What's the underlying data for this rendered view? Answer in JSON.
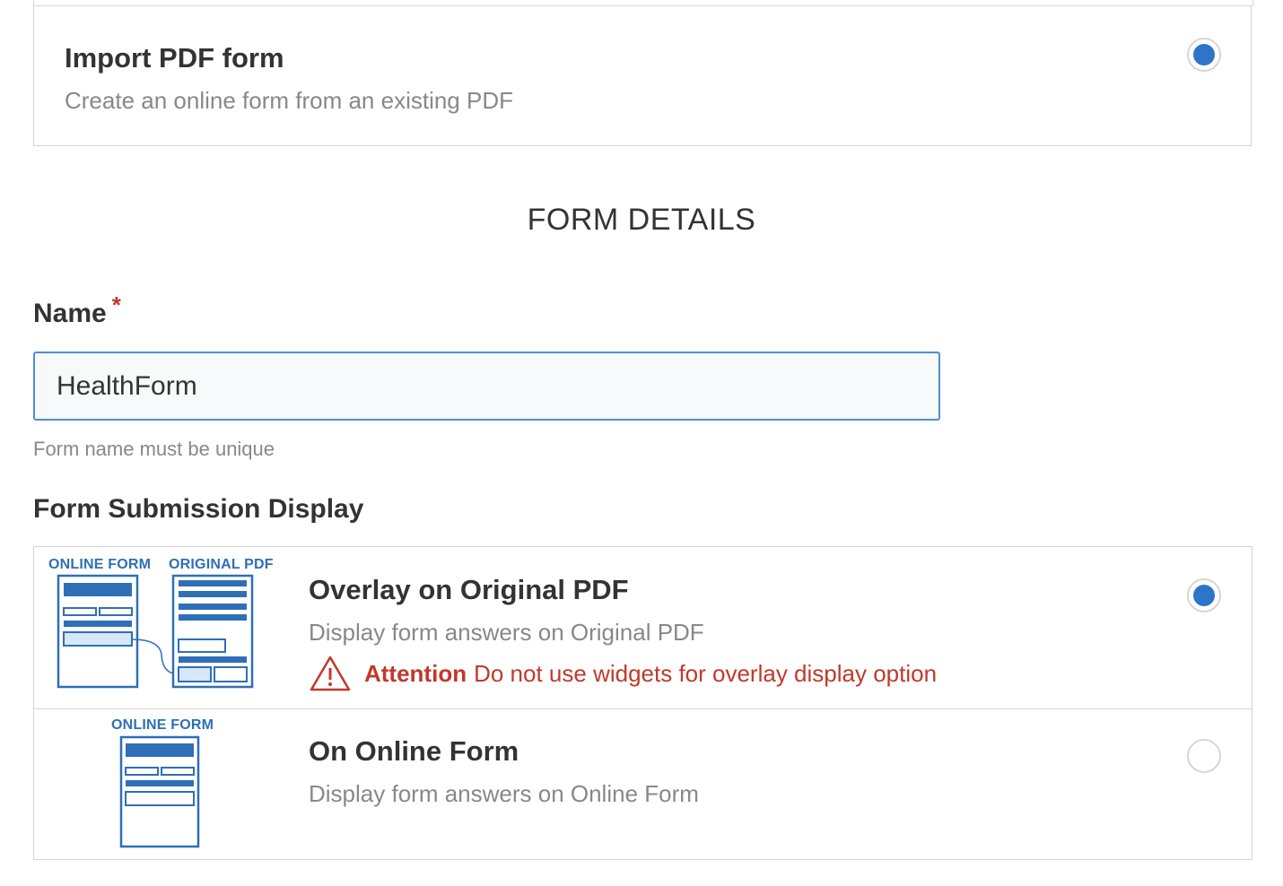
{
  "import_option": {
    "title": "Import PDF form",
    "subtitle": "Create an online form from an existing PDF",
    "selected": true
  },
  "section_heading": "FORM DETAILS",
  "name_field": {
    "label": "Name",
    "required_marker": "*",
    "value": "HealthForm",
    "help_text": "Form name must be unique"
  },
  "submission_display": {
    "label": "Form Submission Display",
    "options": [
      {
        "title": "Overlay on Original PDF",
        "subtitle": "Display form answers on Original PDF",
        "selected": true,
        "illustration_labels": [
          "ONLINE FORM",
          "ORIGINAL PDF"
        ],
        "attention": {
          "label": "Attention",
          "message": "Do not use widgets for overlay display option"
        }
      },
      {
        "title": "On Online Form",
        "subtitle": "Display form answers on Online Form",
        "selected": false,
        "illustration_labels": [
          "ONLINE FORM"
        ]
      }
    ]
  },
  "colors": {
    "accent": "#2e74c9",
    "illustration": "#2e6fb8",
    "warning": "#c0392b",
    "border": "#d4d4d4",
    "muted_text": "#888888"
  }
}
